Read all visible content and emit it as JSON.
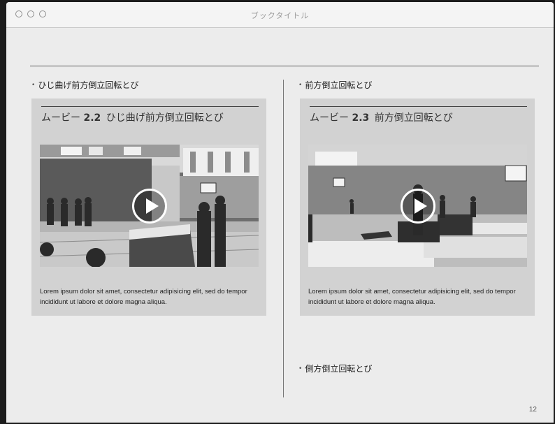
{
  "window": {
    "title": "ブックタイトル"
  },
  "left": {
    "heading": "ひじ曲げ前方倒立回転とび",
    "movie": {
      "prefix": "ムービー",
      "number": "2.2",
      "title": "ひじ曲げ前方倒立回転とび",
      "body": "Lorem ipsum dolor sit amet, consectetur adipisicing elit, sed do tempor incididunt ut labore et dolore magna aliqua."
    }
  },
  "right": {
    "heading": "前方倒立回転とび",
    "movie": {
      "prefix": "ムービー",
      "number": "2.3",
      "title": "前方倒立回転とび",
      "body": "Lorem ipsum dolor sit amet, consectetur adipisicing elit, sed do tempor incididunt ut labore et dolore magna aliqua."
    },
    "next_heading": "側方倒立回転とび"
  },
  "page_number": "12",
  "icons": {
    "play": "play-icon",
    "bullet": "bullet-dot-icon"
  }
}
